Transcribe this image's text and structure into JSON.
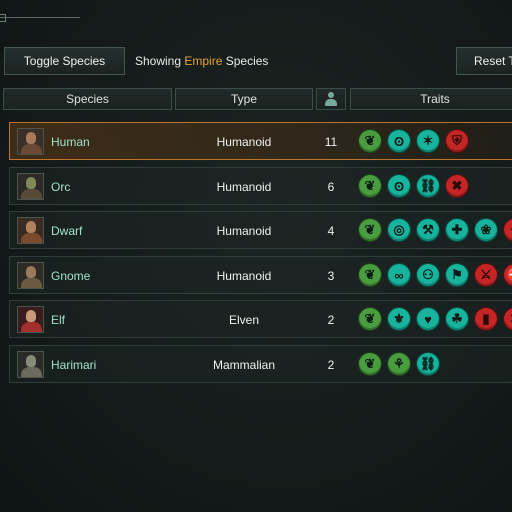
{
  "toolbar": {
    "toggle_label": "Toggle Species",
    "showing_prefix": "Showing",
    "showing_filter": "Empire",
    "showing_suffix": "Species",
    "reset_label": "Reset Te"
  },
  "columns": {
    "species": "Species",
    "type": "Type",
    "count_icon": "person-icon",
    "traits": "Traits"
  },
  "colors": {
    "accent": "#e8a231",
    "selected_border": "#c0742b",
    "trait_green": "#4a9d3f",
    "trait_teal": "#17b39c",
    "trait_red": "#c42626",
    "name_text": "#9fe2c8"
  },
  "rows": [
    {
      "name": "Human",
      "type": "Humanoid",
      "count": "11",
      "selected": true,
      "traits": [
        {
          "color": "green",
          "glyph": "❦",
          "icon": "leaf-icon"
        },
        {
          "color": "teal",
          "glyph": "ʘ",
          "icon": "swirl-icon"
        },
        {
          "color": "teal",
          "glyph": "✶",
          "icon": "adaptive-icon"
        },
        {
          "color": "red",
          "glyph": "⛨",
          "icon": "negative-trait-icon"
        }
      ]
    },
    {
      "name": "Orc",
      "type": "Humanoid",
      "count": "6",
      "selected": false,
      "traits": [
        {
          "color": "green",
          "glyph": "❦",
          "icon": "leaf-icon"
        },
        {
          "color": "teal",
          "glyph": "ʘ",
          "icon": "swirl-icon"
        },
        {
          "color": "teal",
          "glyph": "⛓",
          "icon": "chain-icon"
        },
        {
          "color": "red",
          "glyph": "✖",
          "icon": "negative-trait-icon"
        }
      ]
    },
    {
      "name": "Dwarf",
      "type": "Humanoid",
      "count": "4",
      "selected": false,
      "traits": [
        {
          "color": "green",
          "glyph": "❦",
          "icon": "leaf-icon"
        },
        {
          "color": "teal",
          "glyph": "◎",
          "icon": "rings-icon"
        },
        {
          "color": "teal",
          "glyph": "⚒",
          "icon": "tool-icon"
        },
        {
          "color": "teal",
          "glyph": "✚",
          "icon": "strong-icon"
        },
        {
          "color": "teal",
          "glyph": "❀",
          "icon": "flower-icon"
        },
        {
          "color": "red",
          "glyph": "✦",
          "icon": "negative-trait-icon"
        }
      ]
    },
    {
      "name": "Gnome",
      "type": "Humanoid",
      "count": "3",
      "selected": false,
      "traits": [
        {
          "color": "green",
          "glyph": "❦",
          "icon": "leaf-icon"
        },
        {
          "color": "teal",
          "glyph": "∞",
          "icon": "infinity-icon"
        },
        {
          "color": "teal",
          "glyph": "⚇",
          "icon": "group-icon"
        },
        {
          "color": "teal",
          "glyph": "⚑",
          "icon": "scholar-icon"
        },
        {
          "color": "red",
          "glyph": "⚔",
          "icon": "negative-trait-icon"
        },
        {
          "color": "red",
          "glyph": "⛔",
          "icon": "negative-trait-icon"
        }
      ]
    },
    {
      "name": "Elf",
      "type": "Elven",
      "count": "2",
      "selected": false,
      "traits": [
        {
          "color": "green",
          "glyph": "❦",
          "icon": "leaf-icon"
        },
        {
          "color": "teal",
          "glyph": "⚜",
          "icon": "sigil-icon"
        },
        {
          "color": "teal",
          "glyph": "♥",
          "icon": "charm-icon"
        },
        {
          "color": "teal",
          "glyph": "☘",
          "icon": "nature-icon"
        },
        {
          "color": "red",
          "glyph": "▮",
          "icon": "negative-trait-icon"
        },
        {
          "color": "red",
          "glyph": "✕",
          "icon": "negative-trait-icon"
        }
      ]
    },
    {
      "name": "Harimari",
      "type": "Mammalian",
      "count": "2",
      "selected": false,
      "traits": [
        {
          "color": "green",
          "glyph": "❦",
          "icon": "leaf-icon"
        },
        {
          "color": "green",
          "glyph": "⚘",
          "icon": "beast-icon"
        },
        {
          "color": "teal",
          "glyph": "⛓",
          "icon": "chain-icon"
        }
      ]
    }
  ]
}
